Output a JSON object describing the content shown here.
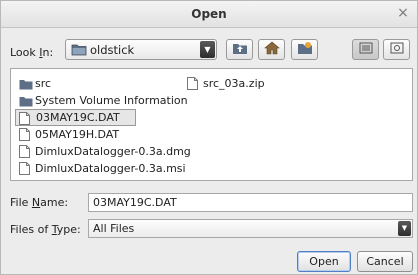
{
  "window": {
    "title": "Open",
    "close_glyph": "×"
  },
  "lookin": {
    "label_pre": "Look ",
    "label_mnemonic": "I",
    "label_post": "n:",
    "value": "oldstick",
    "arrow": "▼"
  },
  "toolbar": [
    {
      "name": "up-one-level-icon"
    },
    {
      "name": "home-icon"
    },
    {
      "name": "create-new-folder-icon"
    },
    {
      "name": "list-view-icon"
    },
    {
      "name": "details-view-icon"
    }
  ],
  "files": [
    {
      "name": "src",
      "type": "folder",
      "selected": false
    },
    {
      "name": "System Volume Information",
      "type": "folder",
      "selected": false
    },
    {
      "name": "03MAY19C.DAT",
      "type": "file",
      "selected": true
    },
    {
      "name": "05MAY19H.DAT",
      "type": "file",
      "selected": false
    },
    {
      "name": "DimluxDatalogger-0.3a.dmg",
      "type": "file",
      "selected": false
    },
    {
      "name": "DimluxDatalogger-0.3a.msi",
      "type": "file",
      "selected": false
    },
    {
      "name": "src_03a.zip",
      "type": "file",
      "selected": false
    }
  ],
  "filename": {
    "label_pre": "File ",
    "label_mnemonic": "N",
    "label_post": "ame:",
    "value": "03MAY19C.DAT"
  },
  "filetype": {
    "label_pre": "Files of ",
    "label_mnemonic": "T",
    "label_post": "ype:",
    "value": "All Files",
    "arrow": "▼"
  },
  "buttons": {
    "open": "Open",
    "cancel": "Cancel"
  },
  "colors": {
    "selection": "#e6e6e6",
    "accent": "#4f7fc4",
    "folder": "#5c6f86"
  }
}
